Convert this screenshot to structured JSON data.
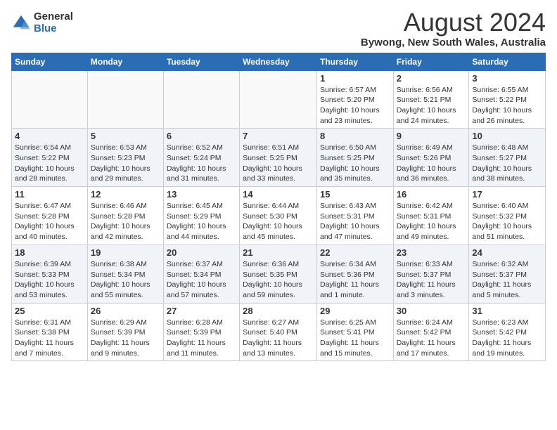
{
  "logo": {
    "general": "General",
    "blue": "Blue"
  },
  "header": {
    "month": "August 2024",
    "location": "Bywong, New South Wales, Australia"
  },
  "weekdays": [
    "Sunday",
    "Monday",
    "Tuesday",
    "Wednesday",
    "Thursday",
    "Friday",
    "Saturday"
  ],
  "weeks": [
    [
      {
        "day": "",
        "info": ""
      },
      {
        "day": "",
        "info": ""
      },
      {
        "day": "",
        "info": ""
      },
      {
        "day": "",
        "info": ""
      },
      {
        "day": "1",
        "info": "Sunrise: 6:57 AM\nSunset: 5:20 PM\nDaylight: 10 hours\nand 23 minutes."
      },
      {
        "day": "2",
        "info": "Sunrise: 6:56 AM\nSunset: 5:21 PM\nDaylight: 10 hours\nand 24 minutes."
      },
      {
        "day": "3",
        "info": "Sunrise: 6:55 AM\nSunset: 5:22 PM\nDaylight: 10 hours\nand 26 minutes."
      }
    ],
    [
      {
        "day": "4",
        "info": "Sunrise: 6:54 AM\nSunset: 5:22 PM\nDaylight: 10 hours\nand 28 minutes."
      },
      {
        "day": "5",
        "info": "Sunrise: 6:53 AM\nSunset: 5:23 PM\nDaylight: 10 hours\nand 29 minutes."
      },
      {
        "day": "6",
        "info": "Sunrise: 6:52 AM\nSunset: 5:24 PM\nDaylight: 10 hours\nand 31 minutes."
      },
      {
        "day": "7",
        "info": "Sunrise: 6:51 AM\nSunset: 5:25 PM\nDaylight: 10 hours\nand 33 minutes."
      },
      {
        "day": "8",
        "info": "Sunrise: 6:50 AM\nSunset: 5:25 PM\nDaylight: 10 hours\nand 35 minutes."
      },
      {
        "day": "9",
        "info": "Sunrise: 6:49 AM\nSunset: 5:26 PM\nDaylight: 10 hours\nand 36 minutes."
      },
      {
        "day": "10",
        "info": "Sunrise: 6:48 AM\nSunset: 5:27 PM\nDaylight: 10 hours\nand 38 minutes."
      }
    ],
    [
      {
        "day": "11",
        "info": "Sunrise: 6:47 AM\nSunset: 5:28 PM\nDaylight: 10 hours\nand 40 minutes."
      },
      {
        "day": "12",
        "info": "Sunrise: 6:46 AM\nSunset: 5:28 PM\nDaylight: 10 hours\nand 42 minutes."
      },
      {
        "day": "13",
        "info": "Sunrise: 6:45 AM\nSunset: 5:29 PM\nDaylight: 10 hours\nand 44 minutes."
      },
      {
        "day": "14",
        "info": "Sunrise: 6:44 AM\nSunset: 5:30 PM\nDaylight: 10 hours\nand 45 minutes."
      },
      {
        "day": "15",
        "info": "Sunrise: 6:43 AM\nSunset: 5:31 PM\nDaylight: 10 hours\nand 47 minutes."
      },
      {
        "day": "16",
        "info": "Sunrise: 6:42 AM\nSunset: 5:31 PM\nDaylight: 10 hours\nand 49 minutes."
      },
      {
        "day": "17",
        "info": "Sunrise: 6:40 AM\nSunset: 5:32 PM\nDaylight: 10 hours\nand 51 minutes."
      }
    ],
    [
      {
        "day": "18",
        "info": "Sunrise: 6:39 AM\nSunset: 5:33 PM\nDaylight: 10 hours\nand 53 minutes."
      },
      {
        "day": "19",
        "info": "Sunrise: 6:38 AM\nSunset: 5:34 PM\nDaylight: 10 hours\nand 55 minutes."
      },
      {
        "day": "20",
        "info": "Sunrise: 6:37 AM\nSunset: 5:34 PM\nDaylight: 10 hours\nand 57 minutes."
      },
      {
        "day": "21",
        "info": "Sunrise: 6:36 AM\nSunset: 5:35 PM\nDaylight: 10 hours\nand 59 minutes."
      },
      {
        "day": "22",
        "info": "Sunrise: 6:34 AM\nSunset: 5:36 PM\nDaylight: 11 hours\nand 1 minute."
      },
      {
        "day": "23",
        "info": "Sunrise: 6:33 AM\nSunset: 5:37 PM\nDaylight: 11 hours\nand 3 minutes."
      },
      {
        "day": "24",
        "info": "Sunrise: 6:32 AM\nSunset: 5:37 PM\nDaylight: 11 hours\nand 5 minutes."
      }
    ],
    [
      {
        "day": "25",
        "info": "Sunrise: 6:31 AM\nSunset: 5:38 PM\nDaylight: 11 hours\nand 7 minutes."
      },
      {
        "day": "26",
        "info": "Sunrise: 6:29 AM\nSunset: 5:39 PM\nDaylight: 11 hours\nand 9 minutes."
      },
      {
        "day": "27",
        "info": "Sunrise: 6:28 AM\nSunset: 5:39 PM\nDaylight: 11 hours\nand 11 minutes."
      },
      {
        "day": "28",
        "info": "Sunrise: 6:27 AM\nSunset: 5:40 PM\nDaylight: 11 hours\nand 13 minutes."
      },
      {
        "day": "29",
        "info": "Sunrise: 6:25 AM\nSunset: 5:41 PM\nDaylight: 11 hours\nand 15 minutes."
      },
      {
        "day": "30",
        "info": "Sunrise: 6:24 AM\nSunset: 5:42 PM\nDaylight: 11 hours\nand 17 minutes."
      },
      {
        "day": "31",
        "info": "Sunrise: 6:23 AM\nSunset: 5:42 PM\nDaylight: 11 hours\nand 19 minutes."
      }
    ]
  ]
}
